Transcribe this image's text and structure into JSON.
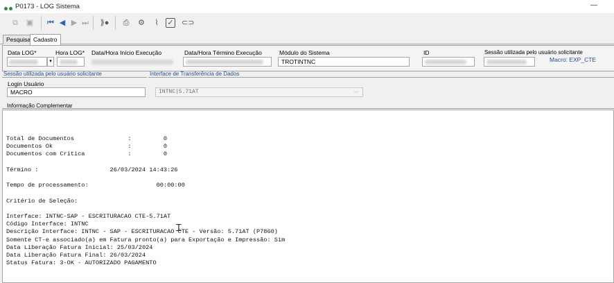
{
  "window": {
    "title": "P0173 - LOG Sistema",
    "minimize_glyph": "—"
  },
  "toolbar": {
    "icons": [
      "copy-icon",
      "save-icon",
      "first-record-icon",
      "previous-record-icon",
      "next-record-icon",
      "last-record-icon",
      "execute-icon",
      "print-icon",
      "settings-icon",
      "attach-icon",
      "confirm-icon",
      "link-icon"
    ]
  },
  "tabs": [
    {
      "label": "Pesquisa"
    },
    {
      "label": "Cadastro"
    }
  ],
  "form": {
    "data_log_label": "Data LOG*",
    "hora_log_label": "Hora LOG*",
    "inicio_label": "Data/Hora Início Execução",
    "termino_label": "Data/Hora Término Execução",
    "modulo_label": "Módulo do Sistema",
    "modulo_value": "TROTINTNC",
    "id_label": "ID",
    "sessao_label": "Sessão utilizada pelo usuário solicitante",
    "macro_value": "Macro: EXP_CTE"
  },
  "section2": {
    "sessao_header": "Sessão utilizada pelo usuário solicitante",
    "interface_header": "Interface de Transferência de Dados",
    "login_label": "Login Usuário",
    "login_value": "MACRO",
    "interface_value": "INTNC|5.71AT"
  },
  "info": {
    "header": "Informação Complementar",
    "log_text": "Total de Documentos               :         0\nDocumentos Ok                     :         0\nDocumentos com Critica            :         0\n\nTérmino :                    26/03/2024 14:43:26\n\nTempo de processamento:                   00:00:00\n\nCritério de Seleção:\n\nInterface: INTNC-SAP - ESCRITURACAO CTE-5.71AT\nCódigo Interface: INTNC\nDescrição Interface: INTNC - SAP - ESCRITURACAO CTE - Versão: 5.71AT (P7860)\nSomente CT-e associado(a) em Fatura pronto(a) para Exportação e Impressão: Sim\nData Liberação Fatura Inicial: 25/03/2024\nData Liberação Fatura Final: 26/03/2024\nStatus Fatura: 3-OK - AUTORIZADO PAGAMENTO"
  }
}
